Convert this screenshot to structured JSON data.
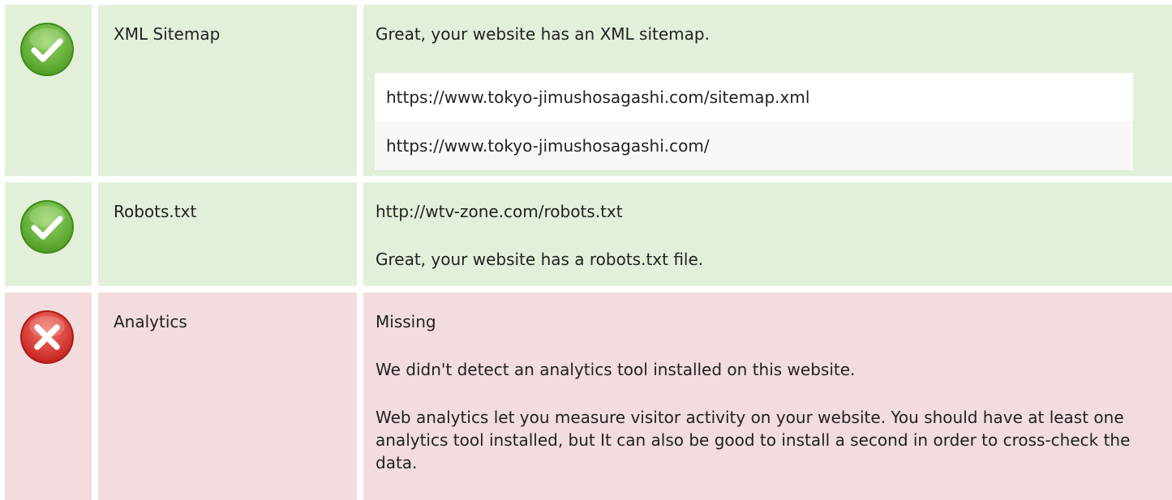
{
  "colors": {
    "pass_bg": "#e2efd9",
    "fail_bg": "#f2dcdd",
    "pass_icon": "#6cbf3d",
    "fail_icon": "#e0403c"
  },
  "rows": {
    "sitemap": {
      "status_icon": "check-icon",
      "label": "XML Sitemap",
      "message": "Great, your website has an XML sitemap.",
      "urls": [
        "https://www.tokyo-jimushosagashi.com/sitemap.xml",
        "https://www.tokyo-jimushosagashi.com/"
      ]
    },
    "robots": {
      "status_icon": "check-icon",
      "label": "Robots.txt",
      "url": "http://wtv-zone.com/robots.txt",
      "message": "Great, your website has a robots.txt file."
    },
    "analytics": {
      "status_icon": "cross-icon",
      "label": "Analytics",
      "status": "Missing",
      "message": "We didn't detect an analytics tool installed on this website.",
      "description": "Web analytics let you measure visitor activity on your website. You should have at least one analytics tool installed, but It can also be good to install a second in order to cross-check the data."
    }
  }
}
